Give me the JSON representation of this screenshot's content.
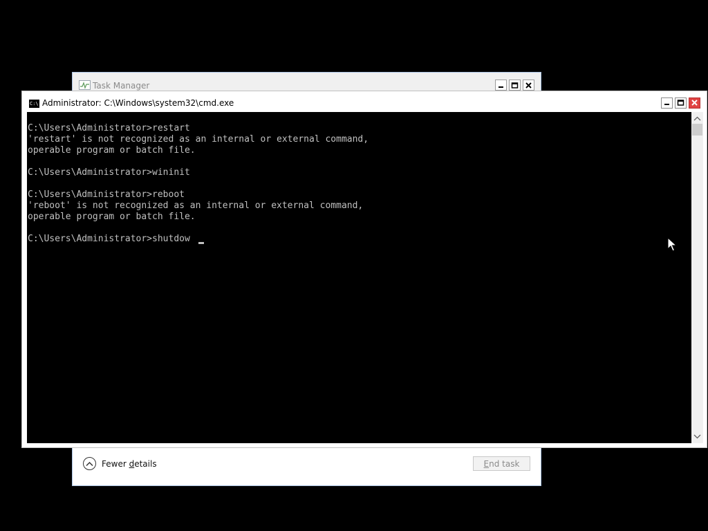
{
  "task_manager": {
    "title": "Task Manager",
    "fewer_details_pre": "Fewer ",
    "fewer_details_underlined": "d",
    "fewer_details_post": "etails",
    "end_task_pre": "",
    "end_task_underlined": "E",
    "end_task_post": "nd task"
  },
  "cmd": {
    "title": "Administrator: C:\\Windows\\system32\\cmd.exe",
    "icon_text": "C:\\",
    "console_lines": [
      "C:\\Users\\Administrator>restart",
      "'restart' is not recognized as an internal or external command,",
      "operable program or batch file.",
      "",
      "C:\\Users\\Administrator>wininit",
      "",
      "C:\\Users\\Administrator>reboot",
      "'reboot' is not recognized as an internal or external command,",
      "operable program or batch file.",
      "",
      "C:\\Users\\Administrator>shutdow"
    ]
  },
  "colors": {
    "console_bg": "#000000",
    "console_text": "#c0c0c0",
    "close_button": "#e04343"
  }
}
